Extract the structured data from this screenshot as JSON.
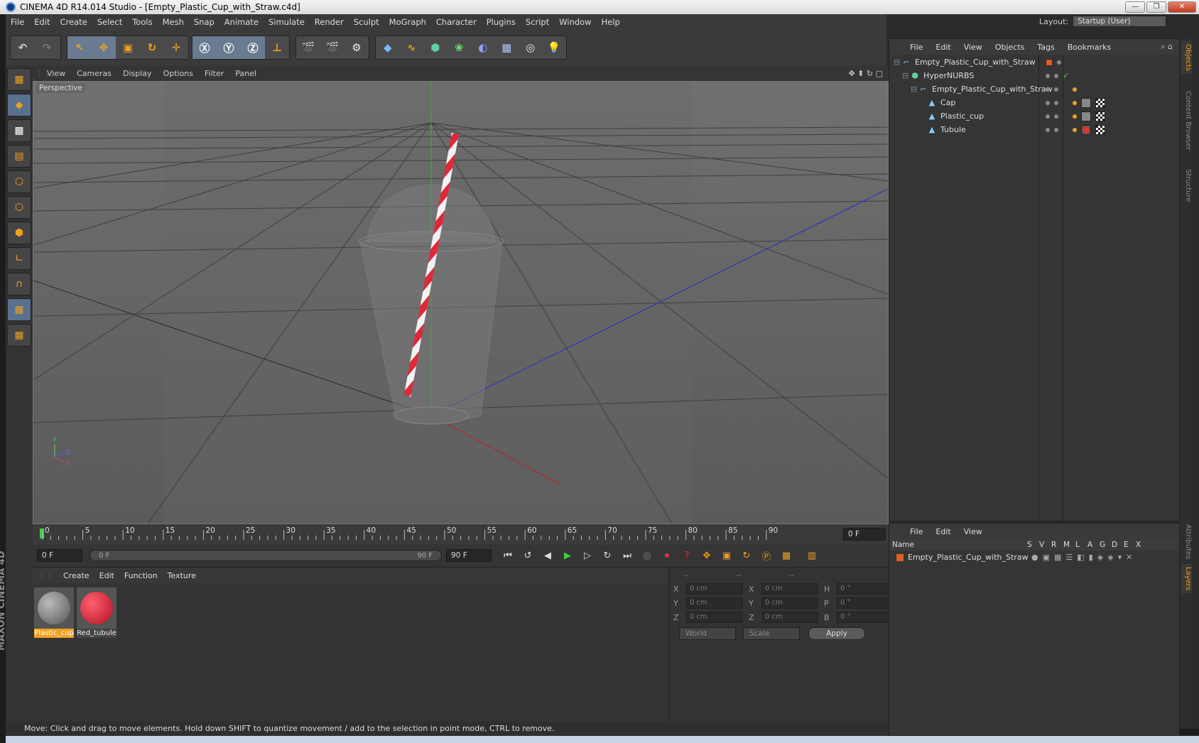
{
  "window": {
    "title": "CINEMA 4D R14.014 Studio - [Empty_Plastic_Cup_with_Straw.c4d]",
    "minimize": "—",
    "maximize": "❐",
    "close": "✕"
  },
  "menu": [
    "File",
    "Edit",
    "Create",
    "Select",
    "Tools",
    "Mesh",
    "Snap",
    "Animate",
    "Simulate",
    "Render",
    "Sculpt",
    "MoGraph",
    "Character",
    "Plugins",
    "Script",
    "Window",
    "Help"
  ],
  "layout": {
    "label": "Layout:",
    "value": "Startup (User)"
  },
  "viewport_menu": [
    "View",
    "Cameras",
    "Display",
    "Options",
    "Filter",
    "Panel"
  ],
  "viewport": {
    "label": "Perspective",
    "axis_y": "Y",
    "axis_z": "Z",
    "axis_x": "X"
  },
  "timeline": {
    "ticks": [
      "0",
      "5",
      "10",
      "15",
      "20",
      "25",
      "30",
      "35",
      "40",
      "45",
      "50",
      "55",
      "60",
      "65",
      "70",
      "75",
      "80",
      "85",
      "90"
    ],
    "current_frame": "0 F"
  },
  "transport": {
    "start": "0 F",
    "range_start": "0 F",
    "range_end": "90 F",
    "end": "90 F"
  },
  "material_menu": [
    "Create",
    "Edit",
    "Function",
    "Texture"
  ],
  "materials": [
    {
      "name": "Plastic_cup",
      "selected": true,
      "color": "#6a6a6a"
    },
    {
      "name": "Red_tubule",
      "selected": false,
      "color": "#d02030"
    }
  ],
  "coords": {
    "headers": [
      "--",
      "--",
      "--"
    ],
    "rows": [
      {
        "l1": "X",
        "v1": "0 cm",
        "l2": "X",
        "v2": "0 cm",
        "l3": "H",
        "v3": "0 °"
      },
      {
        "l1": "Y",
        "v1": "0 cm",
        "l2": "Y",
        "v2": "0 cm",
        "l3": "P",
        "v3": "0 °"
      },
      {
        "l1": "Z",
        "v1": "0 cm",
        "l2": "Z",
        "v2": "0 cm",
        "l3": "B",
        "v3": "0 °"
      }
    ],
    "mode1": "World",
    "mode2": "Scale",
    "apply": "Apply"
  },
  "status": "Move: Click and drag to move elements. Hold down SHIFT to quantize movement / add to the selection in point mode, CTRL to remove.",
  "objects_menu": [
    "File",
    "Edit",
    "View",
    "Objects",
    "Tags",
    "Bookmarks"
  ],
  "objects": [
    {
      "name": "Empty_Plastic_Cup_with_Straw",
      "indent": 0,
      "icon": "null-icon"
    },
    {
      "name": "HyperNURBS",
      "indent": 1,
      "icon": "hypernurbs-icon"
    },
    {
      "name": "Empty_Plastic_Cup_with_Straw",
      "indent": 2,
      "icon": "null-icon"
    },
    {
      "name": "Cap",
      "indent": 3,
      "icon": "polygon-icon"
    },
    {
      "name": "Plastic_cup",
      "indent": 3,
      "icon": "polygon-icon"
    },
    {
      "name": "Tubule",
      "indent": 3,
      "icon": "polygon-icon"
    }
  ],
  "layers_menu": [
    "File",
    "Edit",
    "View"
  ],
  "layers_header": {
    "name": "Name",
    "cols": [
      "S",
      "V",
      "R",
      "M",
      "L",
      "A",
      "G",
      "D",
      "E",
      "X"
    ]
  },
  "layers": [
    {
      "name": "Empty_Plastic_Cup_with_Straw",
      "color": "#e06020"
    }
  ],
  "right_tabs": [
    "Objects",
    "Content Browser",
    "Structure",
    "Attributes",
    "Layers"
  ],
  "branding": "MAXON CINEMA 4D",
  "colors": {
    "accent": "#f0a020",
    "viewport_bg": "#5c5c5c",
    "straw_red": "#d82030"
  }
}
